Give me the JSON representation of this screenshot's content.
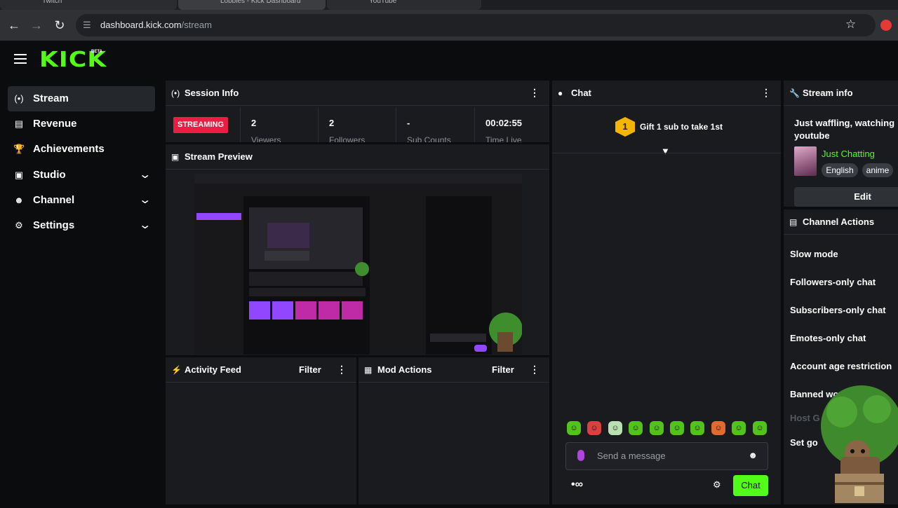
{
  "browser": {
    "tabs": [
      "Twitch",
      "Lobbies - Kick Dashboard",
      "YouTube"
    ],
    "url_host": "dashboard.kick.com",
    "url_path": "/stream"
  },
  "logo": {
    "text": "KICK",
    "badge": "BETA"
  },
  "sidebar": {
    "items": [
      {
        "label": "Stream",
        "icon": "broadcast-icon",
        "active": true
      },
      {
        "label": "Revenue",
        "icon": "chart-icon"
      },
      {
        "label": "Achievements",
        "icon": "trophy-icon"
      },
      {
        "label": "Studio",
        "icon": "studio-icon",
        "expandable": true
      },
      {
        "label": "Channel",
        "icon": "users-icon",
        "expandable": true
      },
      {
        "label": "Settings",
        "icon": "gear-icon",
        "expandable": true
      }
    ]
  },
  "session": {
    "title": "Session Info",
    "status": "STREAMING",
    "stats": [
      {
        "value": "2",
        "label": "Viewers"
      },
      {
        "value": "2",
        "label": "Followers"
      },
      {
        "value": "-",
        "label": "Sub Counts"
      },
      {
        "value": "00:02:55",
        "label": "Time Live"
      }
    ]
  },
  "preview": {
    "title": "Stream Preview"
  },
  "activity": {
    "title": "Activity Feed",
    "filter": "Filter"
  },
  "mod": {
    "title": "Mod Actions",
    "filter": "Filter"
  },
  "chat": {
    "title": "Chat",
    "gift_rank": "1",
    "gift_text": "Gift 1 sub to take 1st",
    "input_placeholder": "Send a message",
    "send_label": "Chat"
  },
  "stream_info": {
    "title": "Stream info",
    "stream_title": "Just waffling, watching youtube",
    "category": "Just Chatting",
    "tags": [
      "English",
      "anime"
    ],
    "edit_label": "Edit"
  },
  "channel_actions": {
    "title": "Channel Actions",
    "items": [
      {
        "label": "Slow mode"
      },
      {
        "label": "Followers-only chat"
      },
      {
        "label": "Subscribers-only chat"
      },
      {
        "label": "Emotes-only chat"
      },
      {
        "label": "Account age restriction"
      },
      {
        "label": "Banned wo"
      },
      {
        "label": "Host G",
        "disabled": true
      },
      {
        "label": "Set go"
      }
    ]
  },
  "colors": {
    "accent": "#53fc18",
    "live": "#e91e44",
    "panel": "#191b1f"
  }
}
